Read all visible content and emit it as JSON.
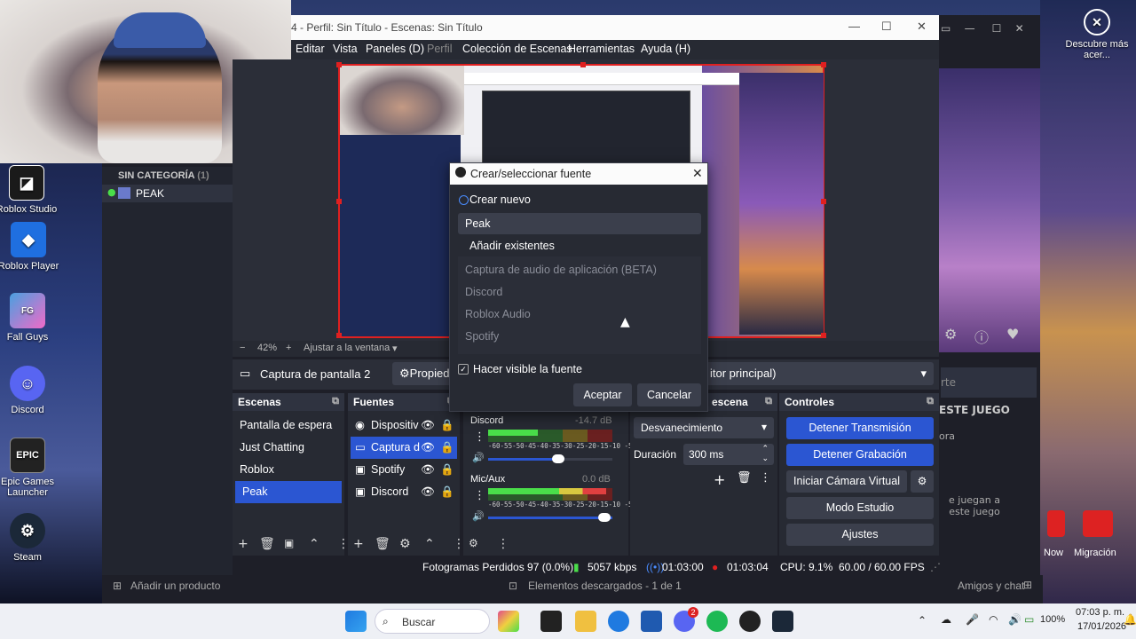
{
  "webcam": {
    "alt": "webcam"
  },
  "obs": {
    "title": "4 - Perfil: Sin Título - Escenas: Sin Título",
    "menu": [
      "Editar",
      "Vista",
      "Paneles (D)",
      "Perfil",
      "Colección de Escenas",
      "Herramientas",
      "Ayuda (H)"
    ],
    "zoom": {
      "percent": "42%",
      "fit": "Ajustar a la ventana"
    },
    "source_bar": {
      "source": "Captura de pantalla 2",
      "props": "Propied",
      "monitor": "itor principal)"
    },
    "scene_tree": {
      "category": "SIN CATEGORÍA",
      "count": "(1)",
      "item": "PEAK"
    },
    "scenes": {
      "title": "Escenas",
      "items": [
        "Pantalla de espera",
        "Just Chatting",
        "Roblox",
        "Peak"
      ],
      "selected": 3
    },
    "sources": {
      "title": "Fuentes",
      "items": [
        "Dispositiv",
        "Captura d",
        "Spotify",
        "Discord"
      ],
      "selected": 1
    },
    "mixer": {
      "tracks": [
        {
          "name": "Discord",
          "db": "-14.7 dB",
          "level": 0.6
        },
        {
          "name": "Mic/Aux",
          "db": "0.0 dB",
          "level": 0.95
        }
      ],
      "scale": "-60-55-50-45-40-35-30-25-20-15-10 -5  0"
    },
    "transitions": {
      "title": "escena",
      "type": "Desvanecimiento",
      "duration_label": "Duración",
      "duration": "300 ms"
    },
    "controls": {
      "title": "Controles",
      "stop_stream": "Detener Transmisión",
      "stop_record": "Detener Grabación",
      "virtual_cam": "Iniciar Cámara Virtual",
      "studio": "Modo Estudio",
      "settings": "Ajustes"
    },
    "status": {
      "dropped": "Fotogramas Perdidos 97 (0.0%)",
      "kbps": "5057 kbps",
      "stream_time": "01:03:00",
      "rec_time": "01:03:04",
      "cpu": "CPU: 9.1%",
      "fps": "60.00 / 60.00 FPS"
    }
  },
  "dialog": {
    "title": "Crear/seleccionar fuente",
    "create_new": "Crear nuevo",
    "name_value": "Peak",
    "add_existing": "Añadir existentes",
    "existing": [
      "Captura de audio de aplicación (BETA)",
      "Discord",
      "Roblox Audio",
      "Spotify"
    ],
    "visible_label": "Hacer visible la fuente",
    "accept": "Aceptar",
    "cancel": "Cancelar"
  },
  "underlying": {
    "add_product": "Añadir un producto",
    "downloads": "Elementos descargados - 1 de 1",
    "friends": "Amigos y chat",
    "game_header": "ESTE JUEGO",
    "game_text1": "ora",
    "game_text2": "e juegan a este juego",
    "search_partial": "rte"
  },
  "desktop_icons": [
    {
      "label": "Roblox Studio",
      "icon": "roblox-studio-icon",
      "color": "#1a1a1a"
    },
    {
      "label": "Roblox Player",
      "icon": "roblox-player-icon",
      "color": "#1f6fe0"
    },
    {
      "label": "Fall Guys",
      "icon": "fall-guys-icon",
      "color": "#4aa0e0"
    },
    {
      "label": "Discord",
      "icon": "discord-icon",
      "color": "#5865f2"
    },
    {
      "label": "Epic Games Launcher",
      "icon": "epic-games-icon",
      "color": "#222222"
    },
    {
      "label": "Steam",
      "icon": "steam-icon",
      "color": "#1b2838"
    }
  ],
  "right_icons": {
    "top": "Descubre más acer...",
    "now": "Now",
    "migracion": "Migración"
  },
  "taskbar": {
    "search": "Buscar",
    "time": "07:03 p. m.",
    "date": "17/01/2026",
    "battery": "100%",
    "badge": "2"
  }
}
